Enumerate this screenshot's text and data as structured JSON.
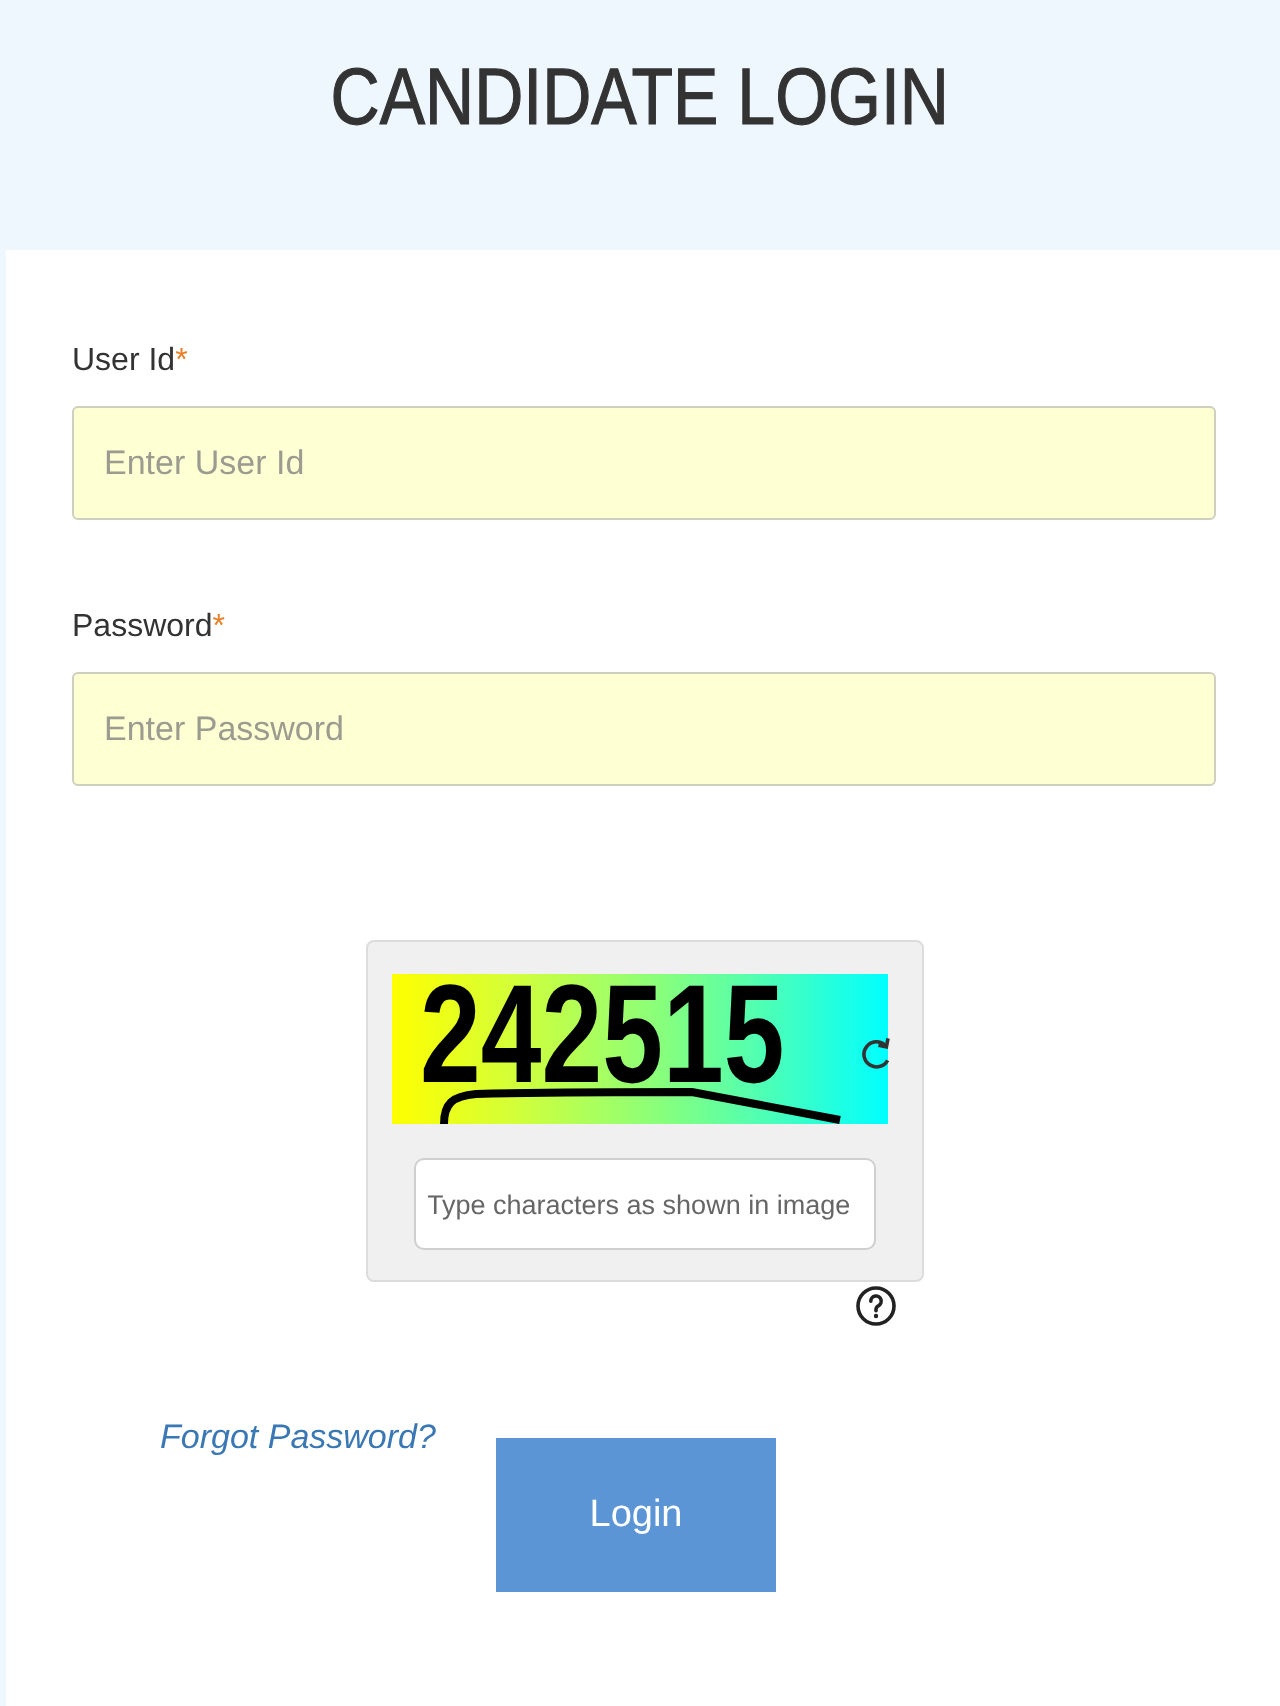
{
  "header": {
    "title": "CANDIDATE LOGIN"
  },
  "fields": [
    {
      "label": "User Id",
      "required_mark": "*",
      "placeholder": "Enter User Id"
    },
    {
      "label": "Password",
      "required_mark": "*",
      "placeholder": "Enter Password"
    }
  ],
  "captcha": {
    "image_text": "242515",
    "placeholder": "Type characters as shown in image"
  },
  "actions": {
    "forgot_link": "Forgot Password?",
    "login_button": "Login"
  }
}
